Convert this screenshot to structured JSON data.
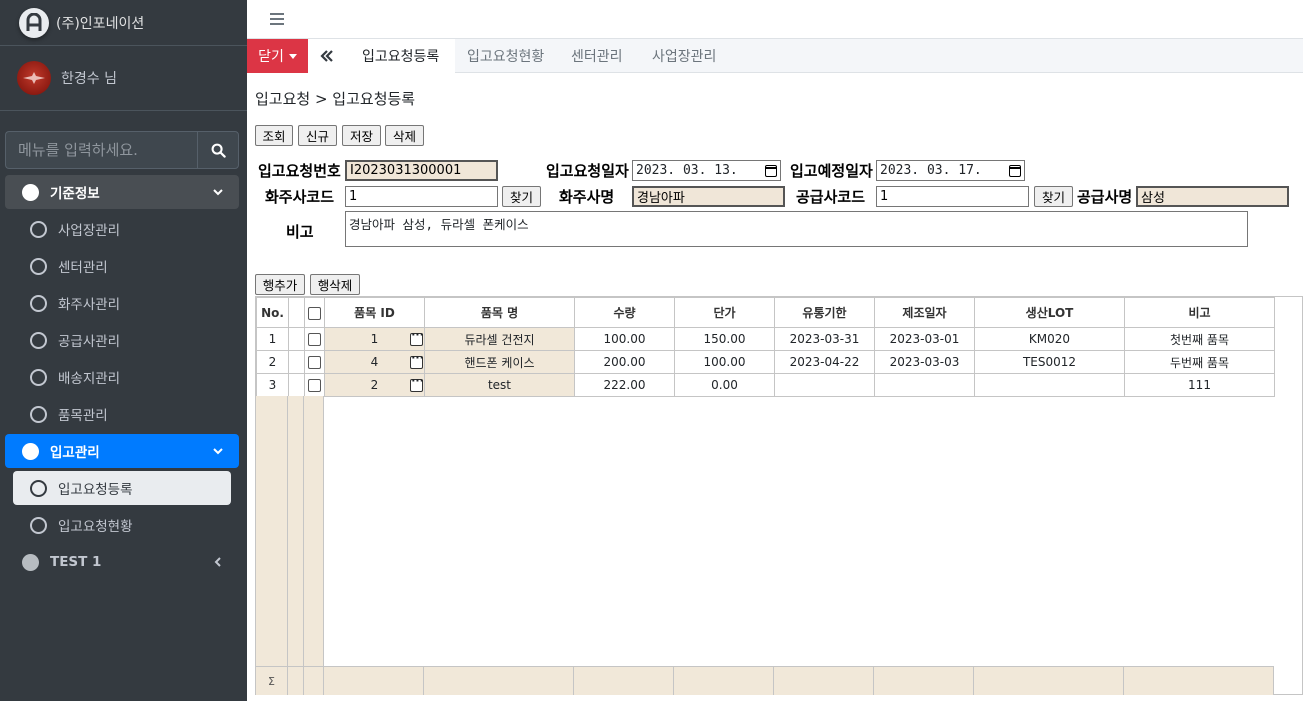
{
  "sidebar": {
    "brand": "(주)인포네이션",
    "user_name": "한경수 님",
    "search_placeholder": "메뉴를 입력하세요.",
    "groups": [
      {
        "label": "기준정보",
        "items": [
          "사업장관리",
          "센터관리",
          "화주사관리",
          "공급사관리",
          "배송지관리",
          "품목관리"
        ]
      },
      {
        "label": "입고관리",
        "items": [
          "입고요청등록",
          "입고요청현황"
        ]
      },
      {
        "label": "TEST 1",
        "items": []
      }
    ]
  },
  "tabbar": {
    "close_label": "닫기",
    "tabs": [
      "입고요청등록",
      "입고요청현황",
      "센터관리",
      "사업장관리"
    ]
  },
  "page": {
    "breadcrumb": "입고요청 > 입고요청등록",
    "buttons": {
      "search": "조회",
      "new": "신규",
      "save": "저장",
      "delete": "삭제"
    },
    "form": {
      "req_no_label": "입고요청번호",
      "req_no_value": "I2023031300001",
      "req_date_label": "입고요청일자",
      "req_date_value": "2023. 03. 13.",
      "plan_date_label": "입고예정일자",
      "plan_date_value": "2023. 03. 17.",
      "owner_code_label": "화주사코드",
      "owner_code_value": "1",
      "find_label": "찾기",
      "owner_name_label": "화주사명",
      "owner_name_value": "경남아파",
      "supplier_code_label": "공급사코드",
      "supplier_code_value": "1",
      "supplier_name_label": "공급사명",
      "supplier_name_value": "삼성",
      "remark_label": "비고",
      "remark_value": "경남아파 삼성, 듀라셀 폰케이스"
    },
    "row_buttons": {
      "add": "행추가",
      "delete": "행삭제"
    }
  },
  "grid": {
    "columns": [
      "No.",
      "",
      "",
      "품목 ID",
      "품목 명",
      "수량",
      "단가",
      "유통기한",
      "제조일자",
      "생산LOT",
      "비고"
    ],
    "rows": [
      {
        "no": "1",
        "id": "1",
        "name": "듀라셀 건전지",
        "qty": "100.00",
        "price": "150.00",
        "exp": "2023-03-31",
        "mfg": "2023-03-01",
        "lot": "KM020",
        "note": "첫번째 품목"
      },
      {
        "no": "2",
        "id": "4",
        "name": "핸드폰 케이스",
        "qty": "200.00",
        "price": "100.00",
        "exp": "2023-04-22",
        "mfg": "2023-03-03",
        "lot": "TES0012",
        "note": "두번째 품목"
      },
      {
        "no": "3",
        "id": "2",
        "name": "test",
        "qty": "222.00",
        "price": "0.00",
        "exp": "",
        "mfg": "",
        "lot": "",
        "note": "111"
      }
    ],
    "sum_symbol": "Σ"
  },
  "colors": {
    "sidebar_bg": "#343a40",
    "active_blue": "#007bff",
    "close_red": "#dc3545",
    "readonly_tan": "#f1e8d9"
  }
}
